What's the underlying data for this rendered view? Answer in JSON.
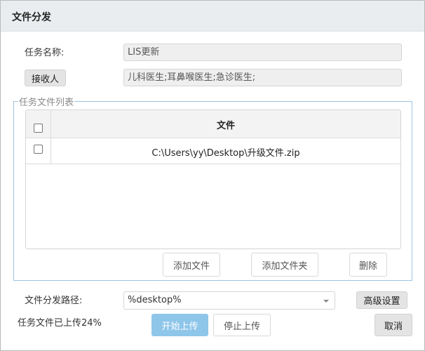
{
  "dialog": {
    "title": "文件分发"
  },
  "form": {
    "task_name_label": "任务名称:",
    "task_name_value": "LIS更新",
    "receiver_button": "接收人",
    "receiver_value": "儿科医生;耳鼻喉医生;急诊医生;"
  },
  "file_list": {
    "legend": "任务文件列表",
    "column_header": "文件",
    "rows": [
      {
        "file": "C:\\Users\\yy\\Desktop\\升级文件.zip",
        "checked": false
      }
    ],
    "buttons": {
      "add_file": "添加文件",
      "add_folder": "添加文件夹",
      "delete": "删除"
    }
  },
  "path": {
    "label": "文件分发路径:",
    "value": "%desktop%",
    "advanced_button": "高级设置"
  },
  "status": {
    "upload_progress_text": "任务文件已上传24%",
    "upload_progress_percent": 24
  },
  "actions": {
    "start_upload": "开始上传",
    "stop_upload": "停止上传",
    "cancel": "取消"
  }
}
